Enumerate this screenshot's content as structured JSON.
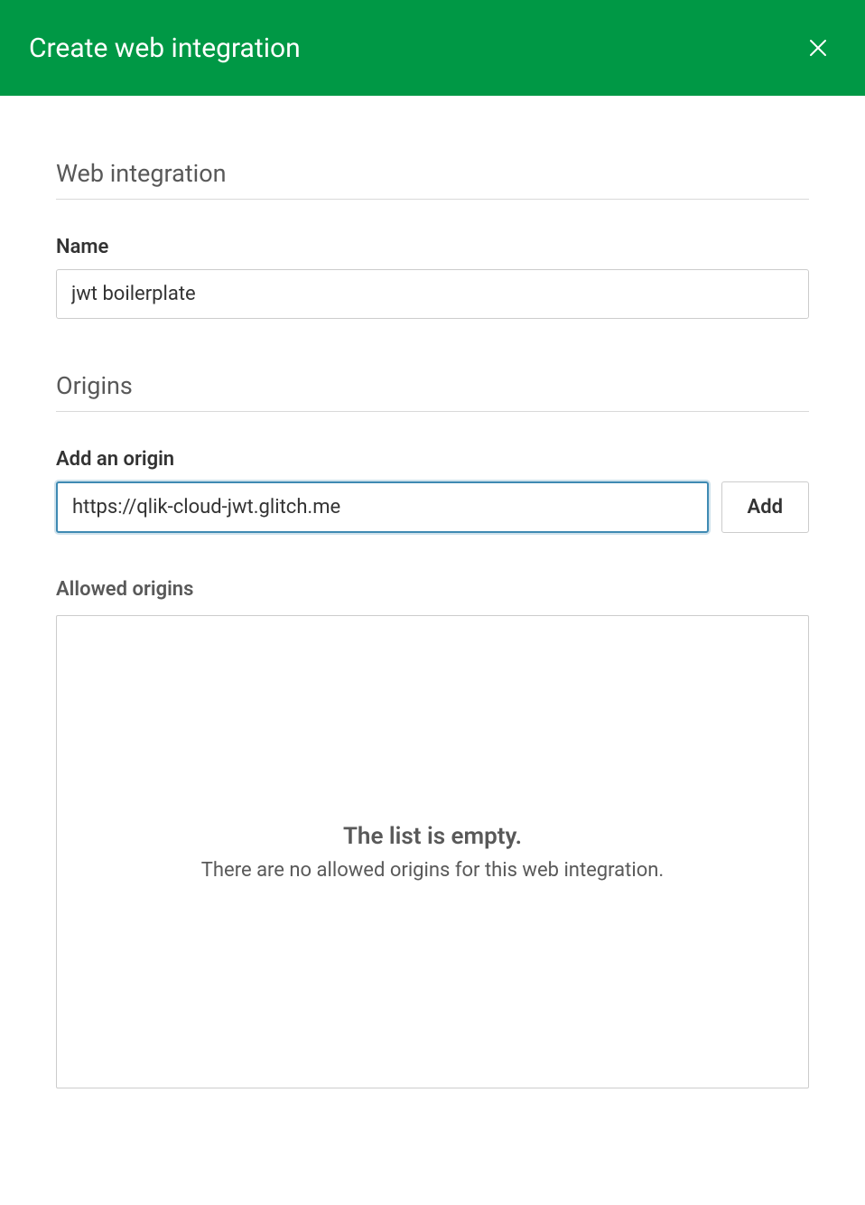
{
  "header": {
    "title": "Create web integration"
  },
  "sections": {
    "web_integration": {
      "heading": "Web integration",
      "name_label": "Name",
      "name_value": "jwt boilerplate"
    },
    "origins": {
      "heading": "Origins",
      "add_label": "Add an origin",
      "add_value": "https://qlik-cloud-jwt.glitch.me",
      "add_button": "Add",
      "allowed_label": "Allowed origins",
      "empty_title": "The list is empty.",
      "empty_sub": "There are no allowed origins for this web integration."
    }
  },
  "colors": {
    "brand_green": "#009845",
    "focus_blue": "#3f8ab3"
  }
}
